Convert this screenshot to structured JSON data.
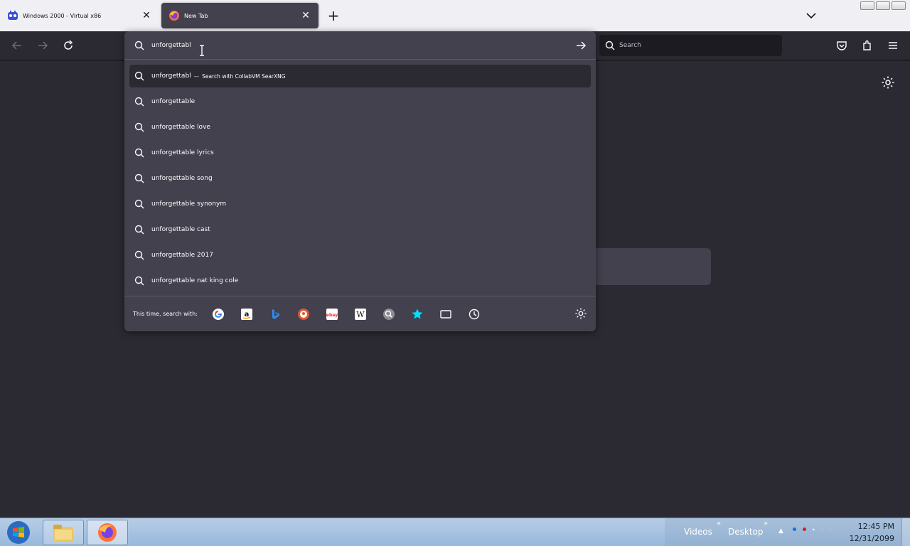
{
  "tabs": [
    {
      "title": "Windows 2000 - Virtual x86",
      "active": false
    },
    {
      "title": "New Tab",
      "active": true
    }
  ],
  "navbar": {
    "search_placeholder": "Search"
  },
  "urlbar": {
    "typed_value": "unforgettabl",
    "selected_suggestion": {
      "text": "unforgettabl",
      "separator": "—",
      "engine_label": "Search with CollabVM SearXNG"
    },
    "suggestions": [
      "unforgettable",
      "unforgettable love",
      "unforgettable lyrics",
      "unforgettable song",
      "unforgettable synonym",
      "unforgettable cast",
      "unforgettable 2017",
      "unforgettable nat king cole"
    ],
    "oneoff_label": "This time, search with:",
    "oneoff_engines": [
      "google-icon",
      "amazon-icon",
      "bing-icon",
      "duckduckgo-icon",
      "ebay-icon",
      "wikipedia-icon",
      "searxng-icon",
      "bookmarks-icon",
      "tabs-icon",
      "history-icon"
    ]
  },
  "taskbar": {
    "toolbars": [
      "Videos",
      "Desktop"
    ],
    "clock_time": "12:45 PM",
    "clock_date": "12/31/2099"
  },
  "colors": {
    "panel": "#42414d",
    "page_bg": "#2b2a33",
    "tabstrip": "#f0f0f4"
  }
}
